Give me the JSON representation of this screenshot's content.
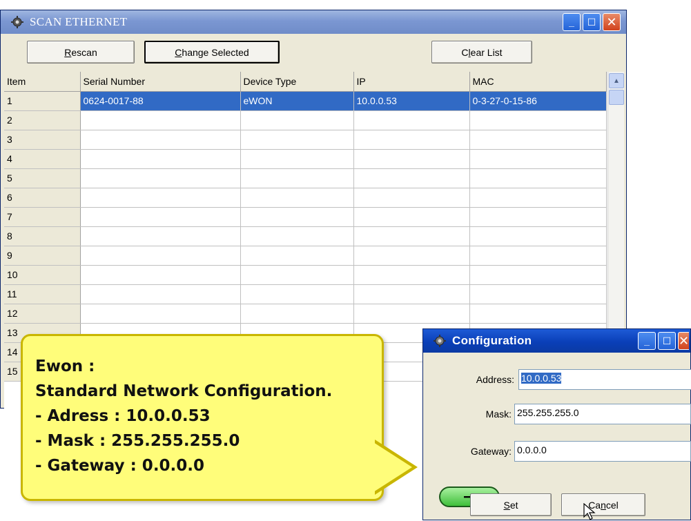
{
  "main": {
    "title": "SCAN ETHERNET",
    "buttons": {
      "rescan_first": "R",
      "rescan_rest": "escan",
      "change_first": "C",
      "change_rest": "hange Selected",
      "clear_first": "C",
      "clear_mid": "l",
      "clear_rest": "ear List"
    },
    "columns": [
      "Item",
      "Serial Number",
      "Device Type",
      "IP",
      "MAC"
    ],
    "rows": [
      [
        "1",
        "0624-0017-88",
        "eWON",
        "10.0.0.53",
        "0-3-27-0-15-86"
      ],
      [
        "2",
        "",
        "",
        "",
        ""
      ],
      [
        "3",
        "",
        "",
        "",
        ""
      ],
      [
        "4",
        "",
        "",
        "",
        ""
      ],
      [
        "5",
        "",
        "",
        "",
        ""
      ],
      [
        "6",
        "",
        "",
        "",
        ""
      ],
      [
        "7",
        "",
        "",
        "",
        ""
      ],
      [
        "8",
        "",
        "",
        "",
        ""
      ],
      [
        "9",
        "",
        "",
        "",
        ""
      ],
      [
        "10",
        "",
        "",
        "",
        ""
      ],
      [
        "11",
        "",
        "",
        "",
        ""
      ],
      [
        "12",
        "",
        "",
        "",
        ""
      ],
      [
        "13",
        "",
        "",
        "",
        ""
      ],
      [
        "14",
        "",
        "",
        "",
        ""
      ],
      [
        "15",
        "",
        "",
        "",
        ""
      ]
    ],
    "selected_row": 0
  },
  "config": {
    "title": "Configuration",
    "address_label": "Address:",
    "address_value": "10.0.0.53",
    "mask_label": "Mask:",
    "mask_value": "255.255.255.0",
    "gateway_label": "Gateway:",
    "gateway_value": "0.0.0.0",
    "set_first": "S",
    "set_rest": "et",
    "cancel_first": "Ca",
    "cancel_u": "n",
    "cancel_rest": "cel"
  },
  "callout": {
    "line1": "Ewon :",
    "line2": "Standard Network Configuration.",
    "line3": "- Adress : 10.0.0.53",
    "line4": "- Mask : 255.255.255.0",
    "line5": "- Gateway : 0.0.0.0"
  },
  "colors": {
    "selection": "#316ac5",
    "callout_fill": "#fffd7a",
    "callout_border": "#c9b600"
  }
}
